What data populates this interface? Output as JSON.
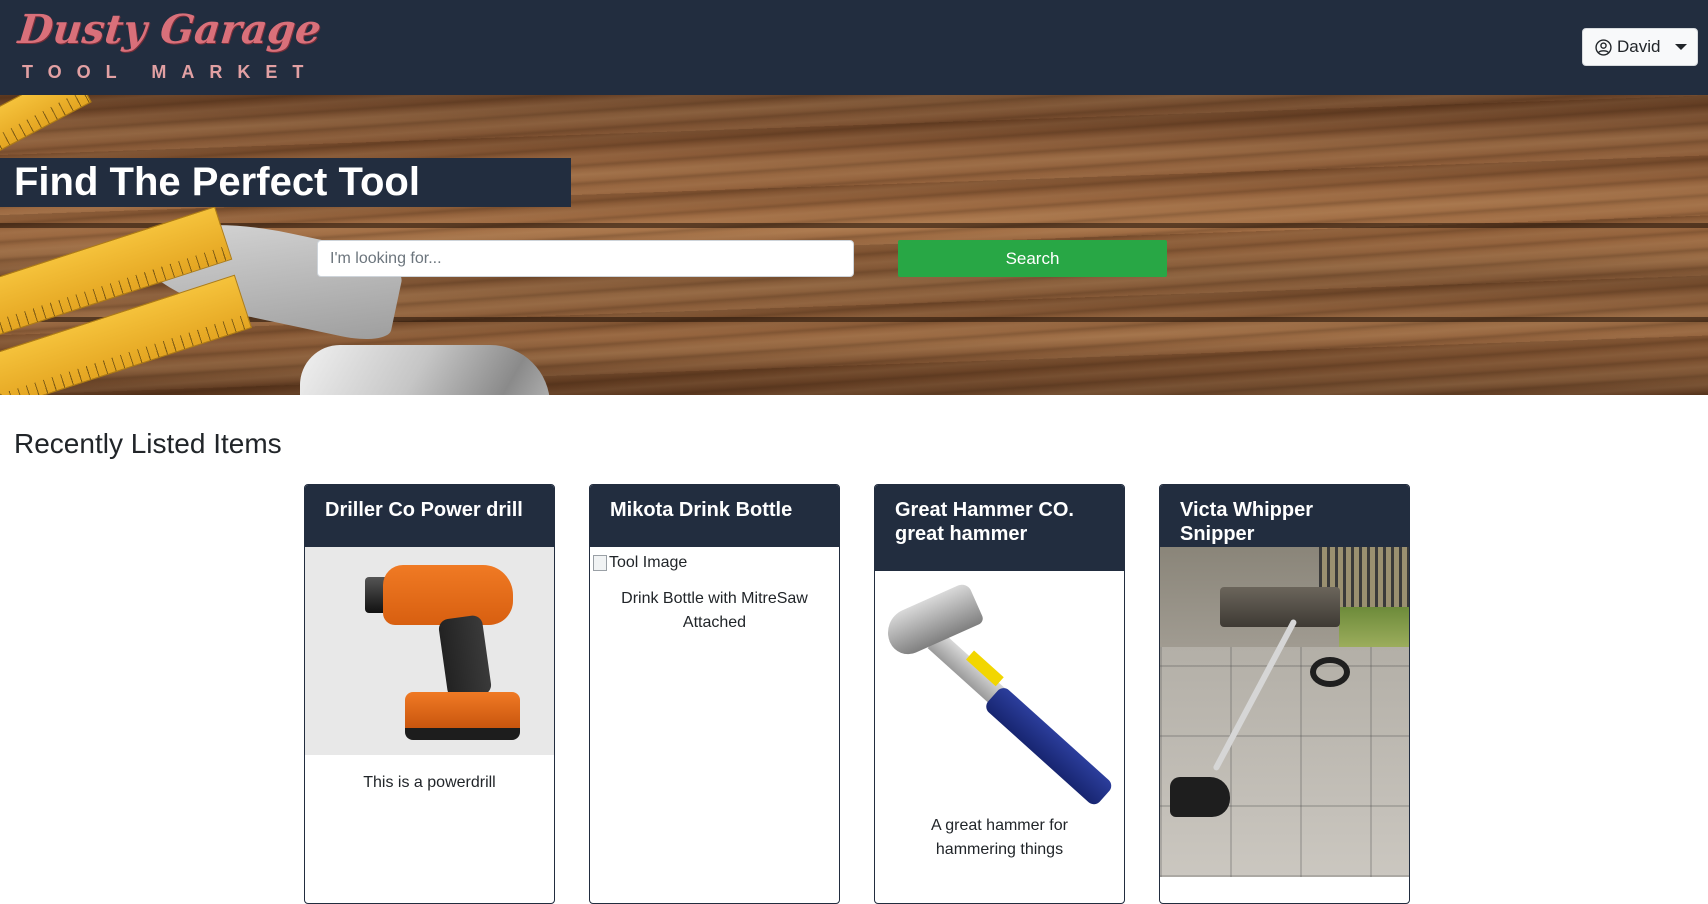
{
  "brand": {
    "logo_script": "Dusty Garage",
    "logo_sub": "TOOL MARKET"
  },
  "user_menu": {
    "name": "David",
    "icon": "user-circle-icon"
  },
  "hero": {
    "title": "Find The Perfect Tool",
    "search_placeholder": "I'm looking for...",
    "search_button": "Search",
    "search_button_color": "#28a745"
  },
  "colors": {
    "navy": "#222d3f",
    "logo_pink": "#d9707a"
  },
  "recent": {
    "heading": "Recently Listed Items",
    "items": [
      {
        "title": "Driller Co Power drill",
        "description": "This is a powerdrill",
        "image": "power-drill-photo"
      },
      {
        "title": "Mikota Drink Bottle",
        "image_alt": "Tool Image",
        "description": "Drink Bottle with MitreSaw Attached",
        "image": "broken-image"
      },
      {
        "title": "Great Hammer CO. great hammer",
        "description": "A great hammer for hammering things",
        "image": "claw-hammer-photo"
      },
      {
        "title": "Victa Whipper Snipper",
        "description": "",
        "image": "whipper-snipper-photo"
      }
    ]
  }
}
